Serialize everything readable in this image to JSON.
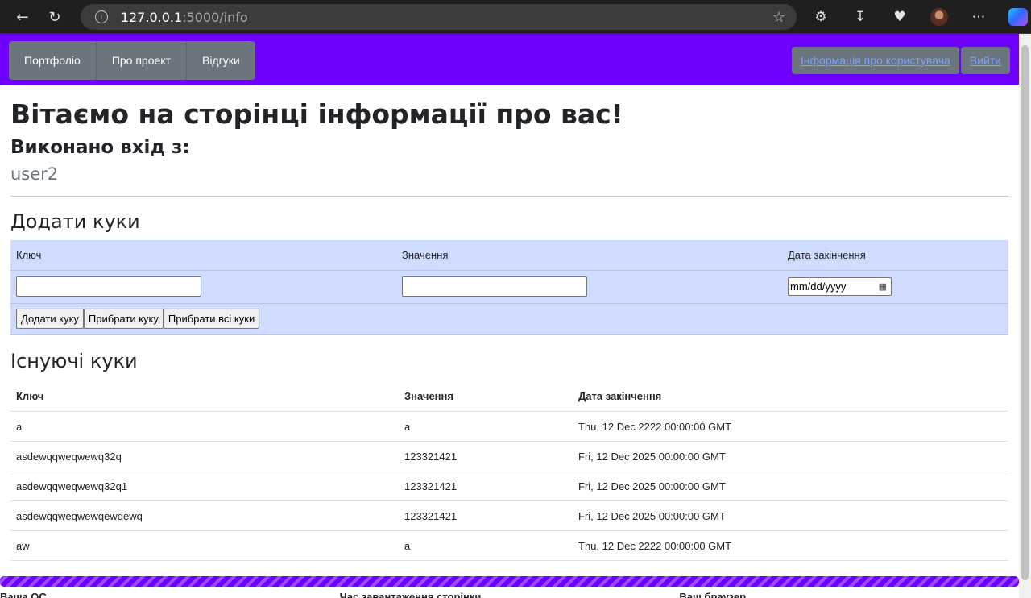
{
  "browser": {
    "url_host": "127.0.0.1",
    "url_path": ":5000/info"
  },
  "nav": {
    "left": [
      "Портфоліо",
      "Про проект",
      "Відгуки"
    ],
    "right": [
      "Інформація про користувача",
      "Вийти"
    ]
  },
  "page": {
    "title": "Вітаємо на сторінці інформації про вас!",
    "login_label": "Виконано вхід з:",
    "username": "user2"
  },
  "add_cookie": {
    "heading": "Додати куки",
    "headers": [
      "Ключ",
      "Значення",
      "Дата закінчення"
    ],
    "key_value": "",
    "value_value": "",
    "date_placeholder": "mm/dd/yyyy",
    "buttons": [
      "Додати куку",
      "Прибрати куку",
      "Прибрати всі куки"
    ]
  },
  "existing_cookies": {
    "heading": "Існуючі куки",
    "headers": [
      "Ключ",
      "Значення",
      "Дата закінчення"
    ],
    "rows": [
      [
        "a",
        "a",
        "Thu, 12 Dec 2222 00:00:00 GMT"
      ],
      [
        "asdewqqweqwewq32q",
        "123321421",
        "Fri, 12 Dec 2025 00:00:00 GMT"
      ],
      [
        "asdewqqweqwewq32q1",
        "123321421",
        "Fri, 12 Dec 2025 00:00:00 GMT"
      ],
      [
        "asdewqqweqwewqewqewq",
        "123321421",
        "Fri, 12 Dec 2025 00:00:00 GMT"
      ],
      [
        "aw",
        "a",
        "Thu, 12 Dec 2222 00:00:00 GMT"
      ]
    ]
  },
  "footer": {
    "labels": [
      "Ваша ОС",
      "Час завантаження сторінки",
      "Ваш браузер"
    ]
  },
  "colors": {
    "navbar": "#6f00ff",
    "form_bg": "#cfdcff",
    "nav_button": "#6c757d"
  }
}
